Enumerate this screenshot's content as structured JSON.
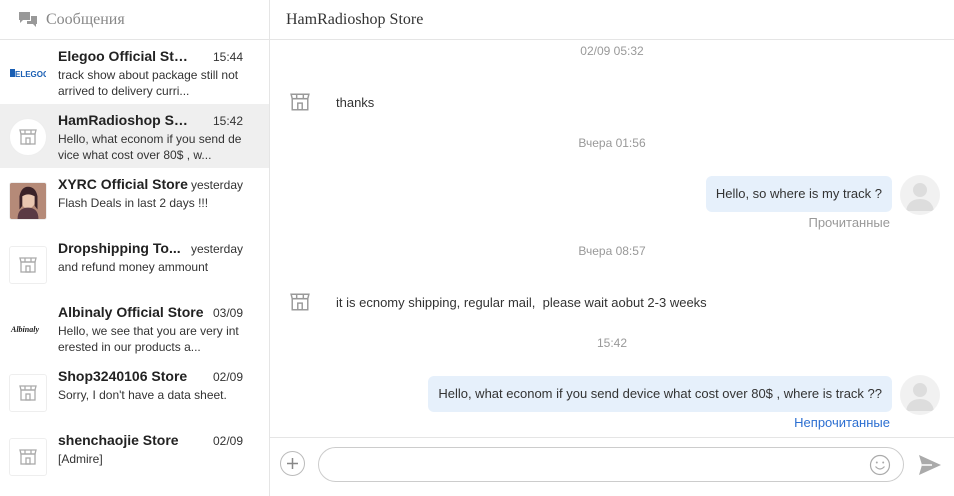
{
  "sidebar": {
    "title": "Сообщения",
    "conversations": [
      {
        "name": "Elegoo Official Store",
        "time": "15:44",
        "preview": "track show about package still not arrived to delivery curri...",
        "avatar": "elegoo-logo",
        "logo_text": "ELEGOO"
      },
      {
        "name": "HamRadioshop Store",
        "time": "15:42",
        "preview": "Hello, what econom if you send de vice what cost over 80$ , w...",
        "avatar": "shop-icon",
        "active": true
      },
      {
        "name": "XYRC Official Store",
        "time": "yesterday",
        "preview": "Flash Deals in last 2 days !!!",
        "avatar": "person-photo"
      },
      {
        "name": "Dropshipping To...",
        "time": "yesterday",
        "preview": "and refund money ammount",
        "avatar": "shop-icon"
      },
      {
        "name": "Albinaly Official Store",
        "time": "03/09",
        "preview": "Hello, we see that you are very int erested in our products a...",
        "avatar": "albinaly-logo",
        "logo_text": "Albinaly"
      },
      {
        "name": "Shop3240106 Store",
        "time": "02/09",
        "preview": "Sorry, I don't have a data sheet.",
        "avatar": "shop-icon"
      },
      {
        "name": "shenchaojie Store",
        "time": "02/09",
        "preview": "[Admire]",
        "avatar": "shop-icon"
      }
    ]
  },
  "chat": {
    "store_name": "HamRadioshop Store",
    "timestamps": [
      "02/09 05:32",
      "Вчера 01:56",
      "Вчера 08:57",
      "15:42"
    ],
    "messages": [
      {
        "direction": "in",
        "text": "thanks"
      },
      {
        "direction": "out",
        "text": "Hello, so where is my track ?",
        "status": "Прочитанные"
      },
      {
        "direction": "in",
        "text": "it is ecnomy shipping, regular mail,  please wait aobut 2-3 weeks"
      },
      {
        "direction": "out",
        "text": "Hello, what econom if you send device what cost over 80$ , where is track ??",
        "status": "Непрочитанные"
      }
    ]
  },
  "composer": {
    "value": "",
    "placeholder": ""
  },
  "colors": {
    "accent_link": "#2c6fd1",
    "bubble_out": "#e6f0fb",
    "active_row": "#efefef"
  }
}
